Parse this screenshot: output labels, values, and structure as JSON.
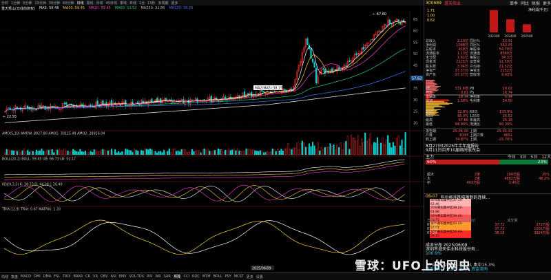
{
  "app": {
    "stock_name": "重天秀山",
    "stock_code": "300689",
    "side_title": "澄天伟业"
  },
  "topbar": {
    "periods": [
      "分时",
      "1分钟",
      "5分钟",
      "15分钟",
      "30分钟",
      "60分钟",
      "日线",
      "周线",
      "月线",
      "45日线",
      "季线",
      "年线",
      "1分",
      "15秒",
      "多周期",
      "更多"
    ]
  },
  "main_legend": {
    "title": "重天秀山(日线前复权)",
    "ma5": "MA5: 59.48",
    "ma10": "MA10: 59.45",
    "ma20": "MA20: 59.45",
    "ma60": "MA60: 53.52",
    "ma250": "MA250: 32.86",
    "ma120": "MA120: 38.29"
  },
  "annotations": {
    "high_label": "67.60",
    "low_label": "22.55",
    "ma_tooltip": "MA2(MA5):38.15",
    "date_label": "2025/06/09",
    "last_price": "57.62"
  },
  "y_axis_ticks": [
    "65",
    "60",
    "55",
    "50",
    "45",
    "40",
    "35",
    "30",
    "25",
    "20"
  ],
  "indicator_panels": [
    {
      "id": "amo",
      "legend": "AMO(5,10)  AMOW: 8927.80  AMO1: 30115.49  AMO2: 28926.04"
    },
    {
      "id": "boll",
      "legend": "BOLL(20,2)  BOLL: 59.45  UB: 66.73  LB: 52.17"
    },
    {
      "id": "kdj",
      "legend": "KDJ(9,3,3)  K: 38.33  D: 44.28  J: 26.48"
    },
    {
      "id": "trix",
      "legend": "TRIX(12,9)  TRIX: 0.67  MATRIX: 1.20"
    }
  ],
  "bottombar": {
    "tabs": [
      "均线",
      "复盘",
      "MACD",
      "DMI",
      "DMA",
      "FSL",
      "TRIX",
      "BRAR",
      "CR",
      "VR",
      "OBV",
      "ASI",
      "EMV",
      "VOL-TDX",
      "RSI",
      "WR",
      "SAR",
      "KDJ",
      "CCI",
      "ROC",
      "MTM",
      "BOLL",
      "PSY",
      "MCST",
      "更多",
      "设置"
    ],
    "active": "KDJ",
    "footer": [
      "财务",
      "关联品种",
      "选股",
      "资金流向",
      "持仓变化",
      "板块信息"
    ]
  },
  "side": {
    "header_code": "300689",
    "header_tabs": [
      "单季",
      "同比",
      "财报",
      "更多"
    ],
    "eps_label": "净利润(千万)",
    "eps_values": [
      "1.71",
      "1.00",
      "0.62"
    ],
    "eps_periods": [
      "202306",
      "202406",
      "202506"
    ],
    "fundamentals": [
      [
        "总收入",
        "2.10亿",
        "同比%",
        "32.91"
      ],
      [
        "净利润",
        "1088万",
        "同比%",
        "562.05"
      ],
      [
        "总股本",
        "428万",
        "每股净",
        "54.70亿"
      ],
      [
        "流通股本",
        "1.13亿",
        "流通值",
        "8580万"
      ],
      [
        "未分配",
        "1.61亿",
        "每股公",
        "34.3万"
      ],
      [
        "现金流",
        "2225万",
        "运营资",
        "11.59万"
      ],
      [
        "股东数",
        "3.04万",
        "户均持",
        "21.52亿"
      ],
      [
        "净资产",
        "37.37万",
        "净资本",
        "2152万"
      ],
      [
        "资产负",
        "-37.37万",
        "营收增",
        "0.43%"
      ]
    ],
    "ratios": [
      [
        "PE",
        "331.6倍",
        "PB",
        "10.02"
      ],
      [
        "PEG",
        "3.61",
        "PS",
        "16.74"
      ],
      [
        "市销率",
        "18.14",
        "净利率",
        "5.14"
      ],
      [
        "ROE",
        "1.58%",
        "毛利率",
        "24.50"
      ]
    ],
    "ratios2": [
      [
        "20日",
        "32.8%",
        "60日",
        "133.9%"
      ],
      [
        "60日",
        "56.0%",
        "120日",
        "26.52"
      ],
      [
        "最高",
        "67.60",
        "年最高",
        "25.18"
      ],
      [
        "最低",
        "68.99%",
        "流通比",
        "60.39%"
      ]
    ],
    "period_rows": [
      [
        "报告期",
        "25-06-30",
        "上期",
        "25-03-31"
      ],
      [
        "户数",
        "8133",
        "上期户数",
        "4651"
      ],
      [
        "较上期",
        "74.87%",
        "上期",
        "-25.70%"
      ]
    ],
    "news": [
      "8月27日(2025年半年度报告",
      "9月11日召开10届临时股东会"
    ],
    "fund_flow_title": "主力",
    "fund_flow_tabs": [
      "今日",
      "3日",
      "5日",
      "12大"
    ],
    "fund_flow_pct": [
      "60%",
      "23%"
    ],
    "fund_flow_rows": [
      [
        "超大",
        "2家",
        "204万股",
        "20%"
      ],
      [
        "大",
        "2家",
        "4882万股",
        "48.2%"
      ],
      [
        "中",
        "463万股",
        "2.45亿"
      ]
    ],
    "events_date": "08-07",
    "events_text": "有价格涨跌幅限制的连续...",
    "chips_legend": [
      "90%筹码集中区37.14-62.46",
      "70%筹码集中区38.22-61.86",
      "50%筹码集中区39.40-58.71",
      "30%筹码集中区43.15-57.07",
      "10%筹码集中区56.93-59.15"
    ],
    "trade_header": [
      "日期",
      "大单交易价",
      "成交量"
    ],
    "trades": [
      [
        "07-28",
        "37.72",
        "372万股"
      ],
      [
        "07-28",
        "37.72",
        "1001万股"
      ],
      [
        "07-24",
        "38.16",
        "3924万股"
      ]
    ],
    "company": "深圳市澄天伟业科技股份有...",
    "cost_label": "成本分布 2025/06/09",
    "cost_avg": "100.0%",
    "footer_stats": "70%成本 25.55 - 35.91 集中15.3%",
    "footer_links": [
      "联系我们",
      "更多",
      "主力",
      "资金流向"
    ]
  },
  "watermark": "雪球：UFO上的网虫",
  "colors": {
    "up": "#ff3030",
    "down": "#00d3d3",
    "ma5": "#ffffff",
    "ma10": "#ffd23a",
    "ma20": "#ff3fd6",
    "ma60": "#22d07a",
    "ma120": "#3f7bff",
    "ma250": "#dddddd"
  }
}
